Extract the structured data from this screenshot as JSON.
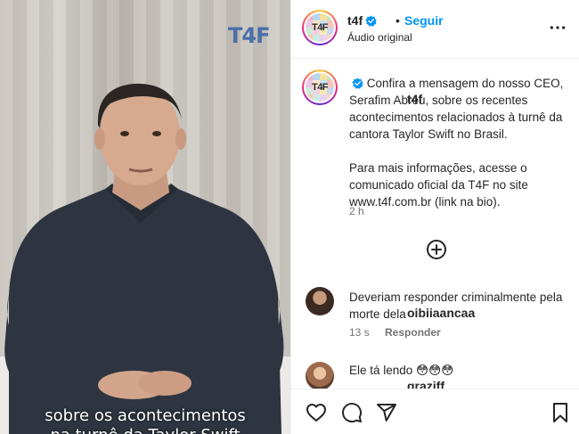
{
  "video": {
    "watermark": "T4F",
    "subtitle_line1": "sobre os acontecimentos",
    "subtitle_line2": "na turnê da Taylor Swift"
  },
  "header": {
    "username": "t4f",
    "separator": "•",
    "follow_label": "Seguir",
    "audio_label": "Áudio original",
    "more_icon": "more-horizontal-icon"
  },
  "post": {
    "username": "t4f",
    "caption_p1": "Confira a mensagem do nosso CEO, Serafim Abreu, sobre os recentes acontecimentos relacionados à turnê da cantora Taylor Swift no Brasil.",
    "caption_p2": "Para mais informações, acesse o comunicado oficial da T4F no site www.t4f.com.br (link na bio).",
    "time": "2 h",
    "load_more_icon": "plus-circle-icon"
  },
  "comments": [
    {
      "username": "oibiiaancaa",
      "text": "Deveriam responder criminalmente pela morte dela",
      "time": "13 s",
      "reply_label": "Responder"
    },
    {
      "username": "graziff_",
      "text": "Ele tá lendo 😳😳😳",
      "time": "",
      "reply_label": ""
    }
  ],
  "actions": {
    "like_icon": "heart-icon",
    "comment_icon": "comment-icon",
    "share_icon": "send-icon",
    "save_icon": "bookmark-icon"
  },
  "colors": {
    "accent": "#0095f6",
    "verified": "#0095f6",
    "muted": "#737373",
    "text": "#262626",
    "watermark": "#4a6fa8"
  }
}
